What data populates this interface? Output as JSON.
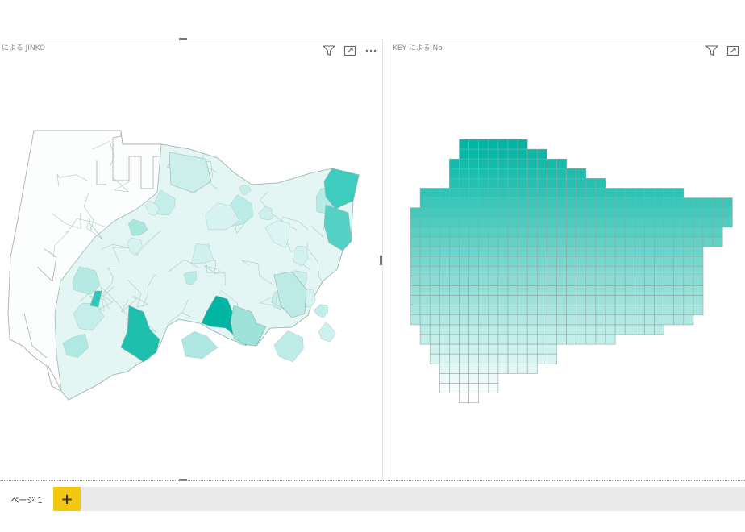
{
  "visuals": [
    {
      "title": "による JINKO",
      "icons": [
        "filter-icon",
        "focus-mode-icon",
        "more-options-icon"
      ]
    },
    {
      "title": "KEY による No",
      "icons": [
        "filter-icon",
        "focus-mode-icon"
      ]
    }
  ],
  "pages": {
    "tabs": [
      {
        "label": "ページ 1"
      }
    ],
    "add_label": "+"
  },
  "colors": {
    "fill_max": "#00b5a3",
    "fill_min": "#ffffff",
    "tab_accent": "#f2c811",
    "tab_bar": "#eaeaea"
  }
}
